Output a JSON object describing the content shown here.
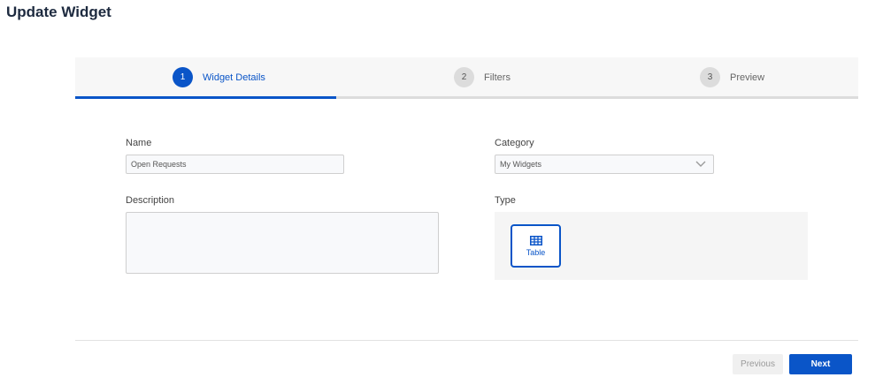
{
  "page": {
    "title": "Update Widget"
  },
  "stepper": {
    "steps": [
      {
        "number": "1",
        "label": "Widget Details",
        "active": true
      },
      {
        "number": "2",
        "label": "Filters",
        "active": false
      },
      {
        "number": "3",
        "label": "Preview",
        "active": false
      }
    ]
  },
  "form": {
    "name": {
      "label": "Name",
      "value": "Open Requests"
    },
    "category": {
      "label": "Category",
      "value": "My Widgets"
    },
    "description": {
      "label": "Description",
      "value": ""
    },
    "type": {
      "label": "Type",
      "options": [
        {
          "label": "Table",
          "icon": "table-icon",
          "selected": true
        }
      ]
    }
  },
  "footer": {
    "previous_label": "Previous",
    "next_label": "Next"
  },
  "colors": {
    "accent": "#0a55c8",
    "inactive_step": "#dcdcdc"
  }
}
